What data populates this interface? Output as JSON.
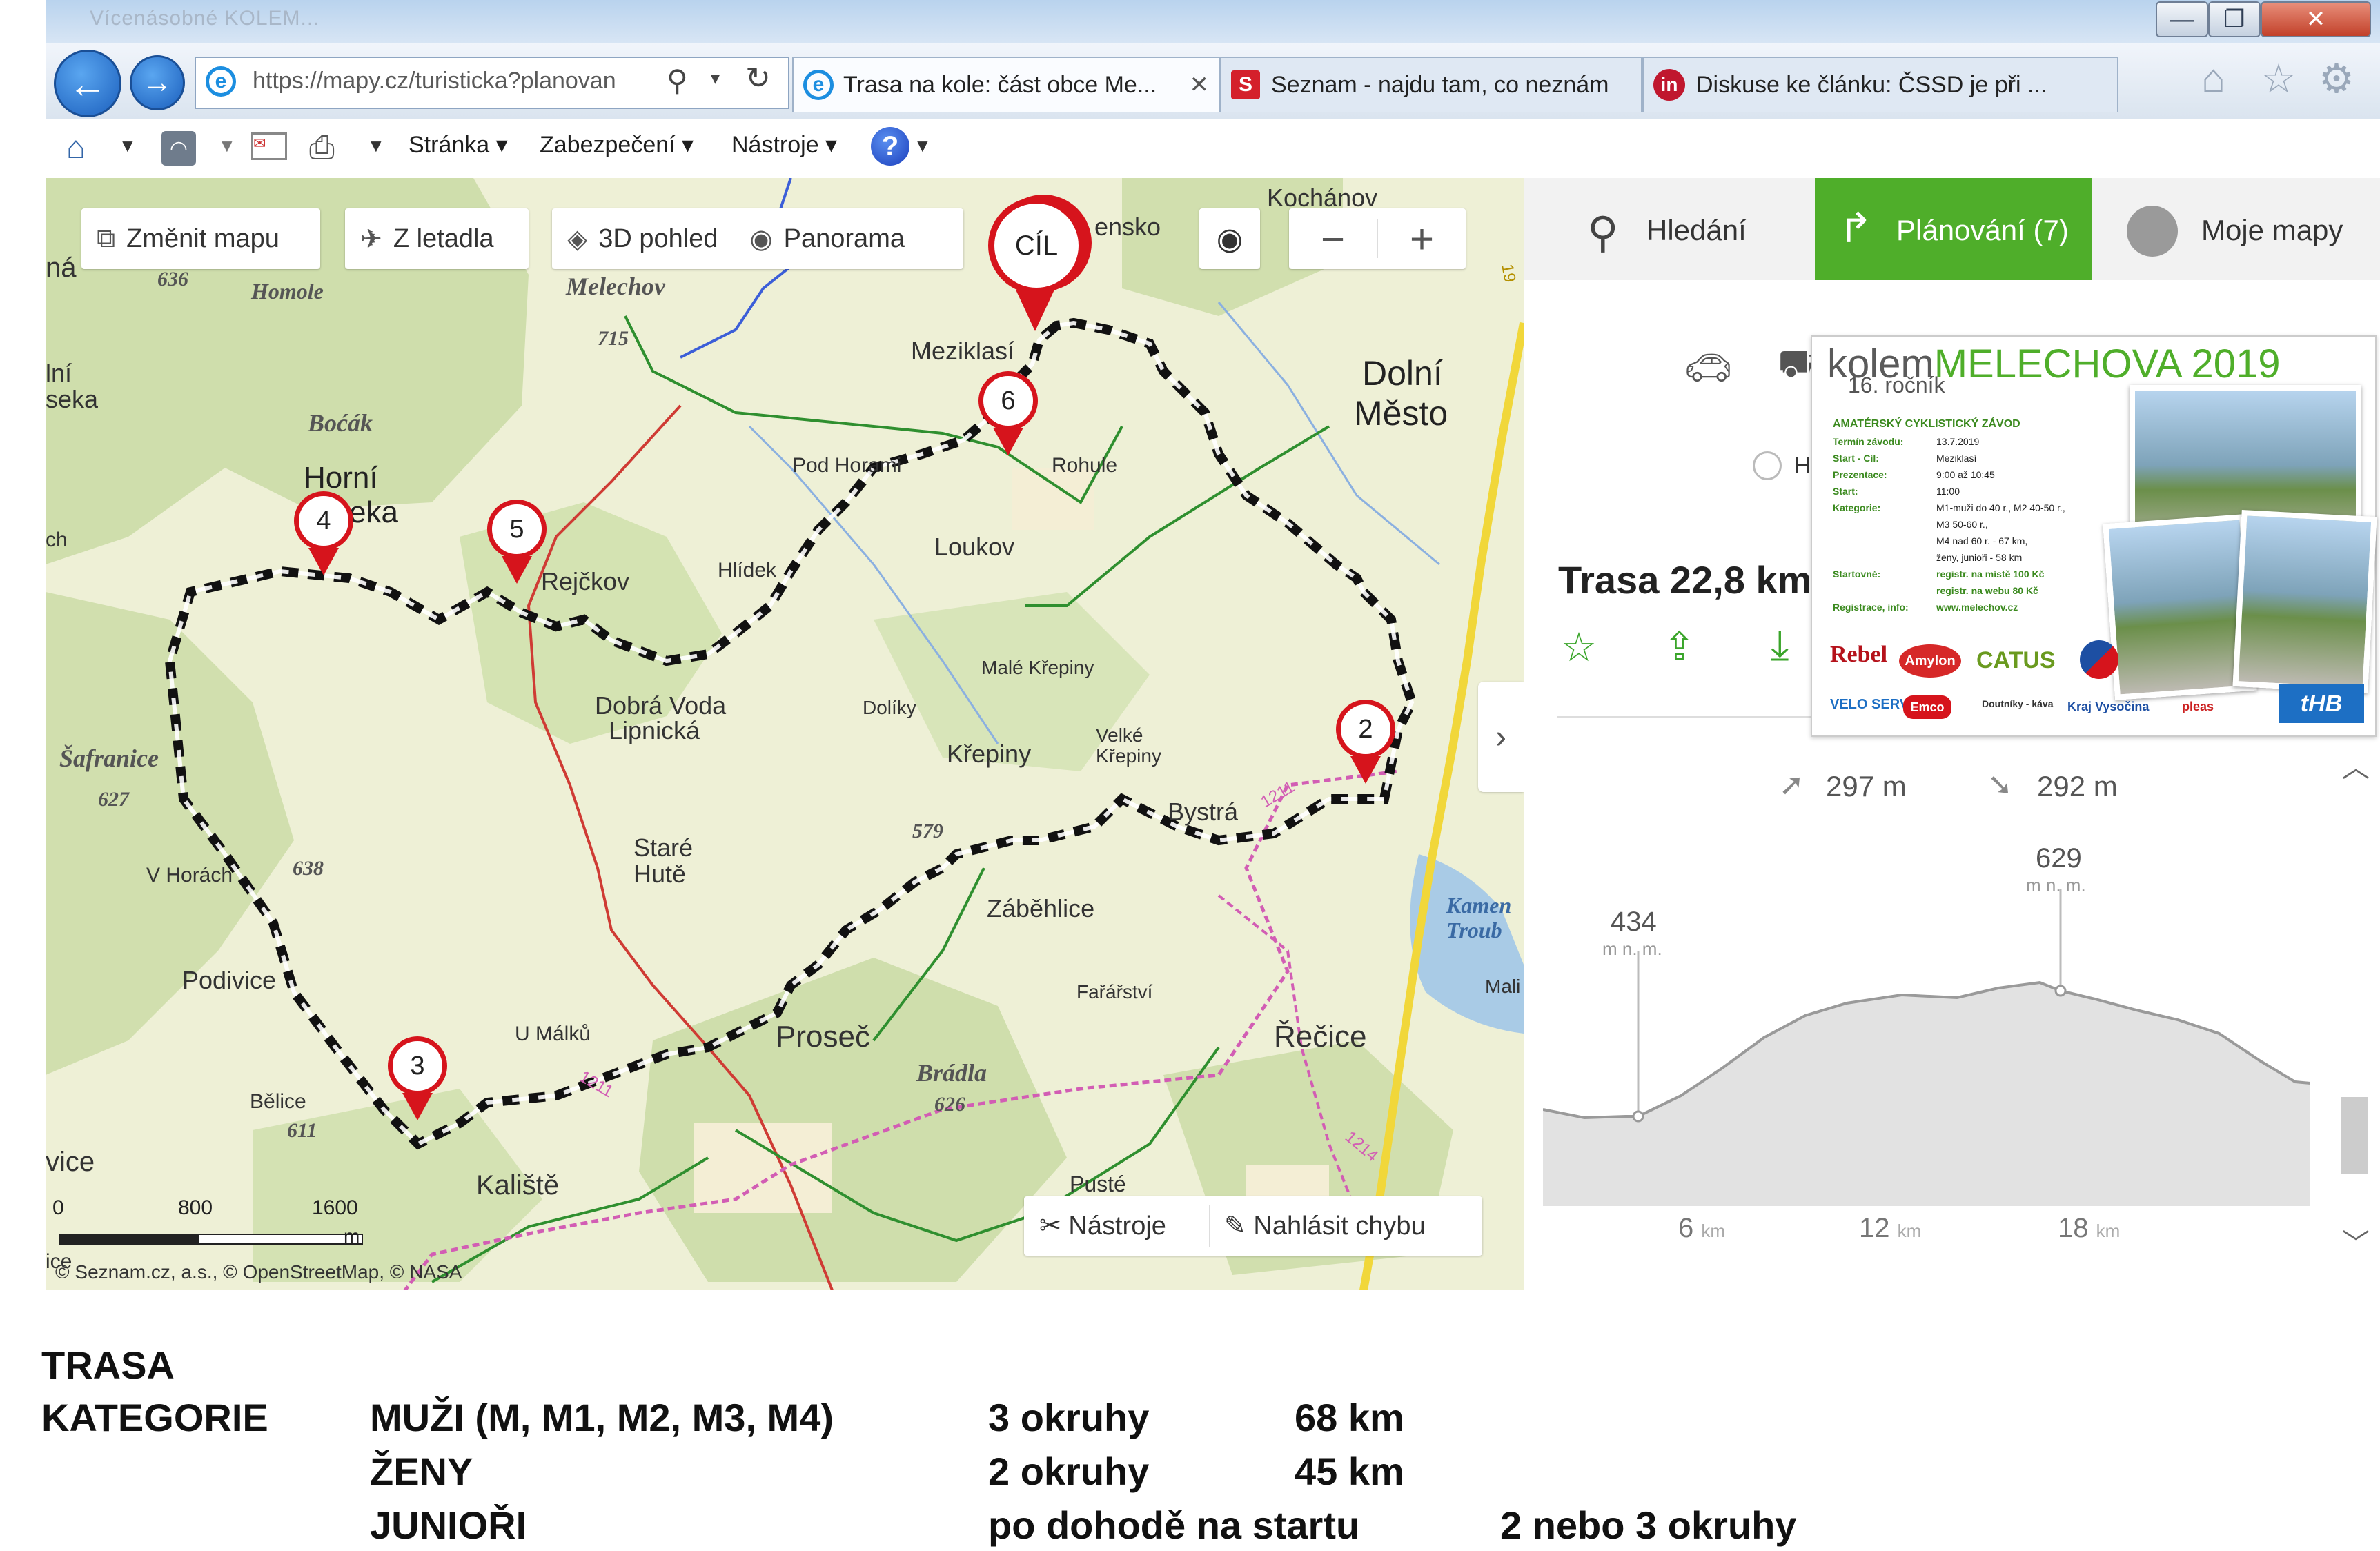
{
  "browser": {
    "window_title": "Vícenásobné KOLEM...",
    "address": "https://mapy.cz/turisticka?planovan",
    "tabs": [
      {
        "label": "Trasa na kole: část obce Me..."
      },
      {
        "label": "Seznam - najdu tam, co neznám"
      },
      {
        "label": "Diskuse ke článku: ČSSD je při ..."
      }
    ],
    "command_bar": {
      "page": "Stránka",
      "security": "Zabezpečení",
      "tools": "Nástroje",
      "help": "?"
    },
    "window_buttons": {
      "minimize": "—",
      "maximize": "❐",
      "close": "✕"
    }
  },
  "map": {
    "toolbar": {
      "change_map": "Změnit mapu",
      "aerial": "Z letadla",
      "view_3d": "3D pohled",
      "panorama": "Panorama",
      "zoom_out": "−",
      "zoom_in": "+"
    },
    "finish_label": "CÍL",
    "waypoints": [
      "2",
      "3",
      "4",
      "5",
      "6"
    ],
    "places": {
      "kochanov": "Kochánov",
      "mezi": "Meziklasí",
      "dolni": "Dolní",
      "mesto": "Město",
      "melechov": "Melechov",
      "h715": "715",
      "h636": "636",
      "homole": "Homole",
      "bocak": "Boćák",
      "horni": "Horní",
      "horni2": "eka",
      "rejckov": "Rejčkov",
      "hlidek": "Hlídek",
      "podhorami": "Pod Horami",
      "rohule": "Rohule",
      "loukov": "Loukov",
      "dobra1": "Dobrá Voda",
      "dobra2": "Lipnická",
      "dolky": "Dolíky",
      "male_krepiny": "Malé Křepiny",
      "krepiny": "Křepiny",
      "velke1": "Velké",
      "velke2": "Křepiny",
      "bystra": "Bystrá",
      "safranice": "Šafranice",
      "h627": "627",
      "vhorach": "V Horách",
      "h638": "638",
      "stare1": "Staré",
      "stare2": "Hutě",
      "h579": "579",
      "zabehlice": "Záběhlice",
      "podivice": "Podivice",
      "umalku": "U Málků",
      "prosec": "Proseč",
      "ricice": "Řečice",
      "farar": "Fařářství",
      "bradla": "Brádla",
      "h626": "626",
      "belice": "Bělice",
      "h611": "611",
      "kaliste": "Kaliště",
      "puste": "Pusté",
      "kamen1": "Kamen",
      "kamen2": "Troub",
      "mali": "Mali",
      "edge_na": "ná",
      "edge_lni": "lní",
      "edge_seka": "seka",
      "edge_ch": "ch",
      "edge_vice": "vice",
      "edge_ice": "ice",
      "ensko": "ensko",
      "r1211a": "1211",
      "r1211b": "1211",
      "r1214": "1214",
      "r19": "19"
    },
    "scale": {
      "zero": "0",
      "mid": "800",
      "max": "1600",
      "unit": "m"
    },
    "tools": "Nástroje",
    "report": "Nahlásit chybu",
    "attribution": "© Seznam.cz, a.s., © OpenStreetMap, © NASA"
  },
  "panel": {
    "nav": {
      "search": "Hledání",
      "planning": "Plánování (7)",
      "my_maps": "Moje mapy"
    },
    "route_length": "Trasa 22,8 km",
    "route_option_cut": "H",
    "ascent": "297 m",
    "descent": "292 m",
    "profile": {
      "start_alt": "434",
      "max_alt": "629",
      "alt_unit": "m n. m.",
      "x_ticks": [
        {
          "value": "6",
          "unit": "km"
        },
        {
          "value": "12",
          "unit": "km"
        },
        {
          "value": "18",
          "unit": "km"
        }
      ]
    },
    "poster": {
      "title_a": "kolem",
      "title_b": "MELECHOVA 2019",
      "edition": "16. ročník",
      "heading": "AMATÉRSKÝ CYKLISTICKÝ ZÁVOD",
      "rows": [
        {
          "k": "Termín závodu:",
          "v": "13.7.2019"
        },
        {
          "k": "Start - Cíl:",
          "v": "Meziklasí"
        },
        {
          "k": "Prezentace:",
          "v": "9:00 až 10:45"
        },
        {
          "k": "Start:",
          "v": "11:00"
        },
        {
          "k": "Kategorie:",
          "v": "M1-muži do 40 r., M2 40-50 r.,"
        },
        {
          "k": "",
          "v": "M3 50-60 r.,"
        },
        {
          "k": "",
          "v": "M4 nad 60 r. - 67 km,"
        },
        {
          "k": "",
          "v": "ženy, junioři - 58 km"
        },
        {
          "k": "Startovné:",
          "v": "registr. na místě 100 Kč"
        },
        {
          "k": "",
          "v": "registr. na webu 80 Kč"
        },
        {
          "k": "Registrace, info:",
          "v": "www.melechov.cz"
        }
      ],
      "sponsors": [
        "Rebel",
        "Amylon",
        "CATUS",
        "VELO SERVIS",
        "Emco",
        "Doutníky - káva",
        "Kraj Vysočina",
        "pleas",
        "tHB"
      ]
    }
  },
  "doc": {
    "trasa": "TRASA",
    "kategorie": "KATEGORIE",
    "rows": [
      {
        "cat": "MUŽI (M, M1, M2, M3, M4)",
        "laps": "3 okruhy",
        "dist": "68 km",
        "extra": ""
      },
      {
        "cat": "ŽENY",
        "laps": "2 okruhy",
        "dist": "45 km",
        "extra": ""
      },
      {
        "cat": "JUNIOŘI",
        "laps": "po dohodě na startu",
        "dist": "",
        "extra": "2 nebo 3 okruhy"
      }
    ]
  }
}
